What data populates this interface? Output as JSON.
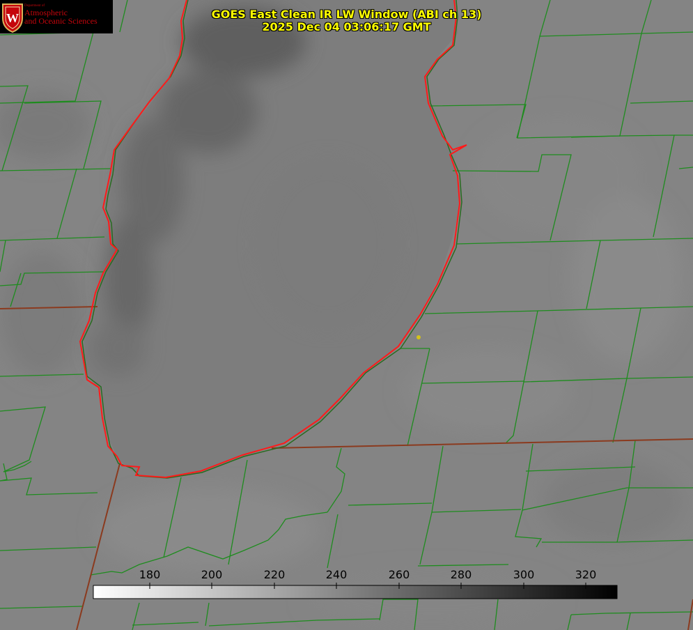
{
  "logo": {
    "dept": "Department of",
    "line1": "Atmospheric",
    "line2": "and Oceanic Sciences",
    "emblem_letter": "W"
  },
  "header": {
    "title_line1": "GOES East Clean IR LW Window (ABI ch 13)",
    "title_line2": "2025 Dec 04 03:06:17 GMT"
  },
  "colorbar": {
    "ticks": [
      "180",
      "200",
      "220",
      "240",
      "260",
      "280",
      "300",
      "320"
    ],
    "range": [
      162,
      330
    ],
    "colors": {
      "low": "#ffffff",
      "high": "#000000"
    }
  },
  "colors": {
    "background": "#808080",
    "county_lines": "#1e8c1e",
    "state_lines": "#8b3a1e",
    "lake_outline": "#ff1a1a",
    "title_text": "#ffff00",
    "marker": "#d4c21a"
  }
}
